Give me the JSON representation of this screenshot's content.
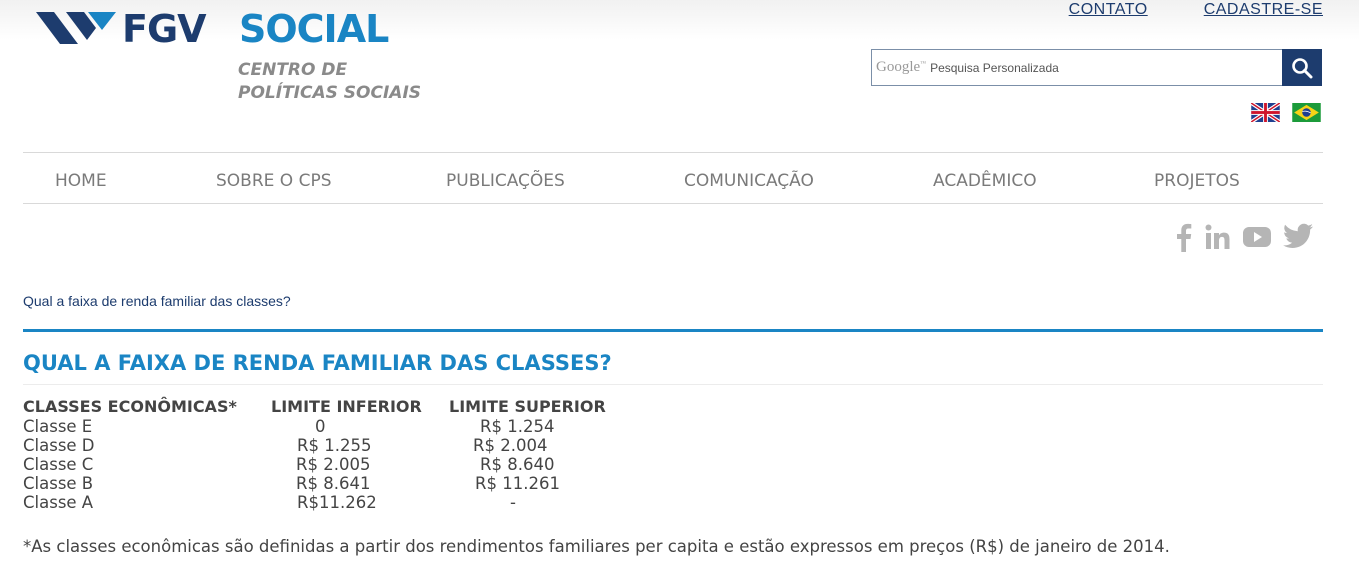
{
  "brand": {
    "logo_word1": "FGV",
    "logo_word2": "SOCIAL",
    "subtitle_line1": "CENTRO DE",
    "subtitle_line2": "POLÍTICAS SOCIAIS",
    "colors": {
      "navy": "#1d3c6e",
      "blue": "#1a85c4",
      "grey": "#8a8a8a"
    }
  },
  "top_links": {
    "contact": "CONTATO",
    "register": "CADASTRE-SE"
  },
  "search": {
    "google_label": "Google",
    "placeholder": "Pesquisa Personalizada",
    "button_icon": "search-icon"
  },
  "languages": [
    {
      "icon": "uk-flag-icon"
    },
    {
      "icon": "brazil-flag-icon"
    }
  ],
  "nav": {
    "items": [
      {
        "label": "HOME"
      },
      {
        "label": "SOBRE O CPS"
      },
      {
        "label": "PUBLICAÇÕES"
      },
      {
        "label": "COMUNICAÇÃO"
      },
      {
        "label": "ACADÊMICO"
      },
      {
        "label": "PROJETOS"
      }
    ]
  },
  "social": [
    "facebook-icon",
    "linkedin-icon",
    "youtube-icon",
    "twitter-icon"
  ],
  "breadcrumb": "Qual a faixa de renda familiar das classes?",
  "page_title": "QUAL A FAIXA DE RENDA FAMILIAR DAS CLASSES?",
  "table": {
    "headers": [
      "CLASSES ECONÔMICAS*",
      "LIMITE INFERIOR",
      "LIMITE SUPERIOR"
    ],
    "rows": [
      [
        "Classe E",
        "0",
        "R$ 1.254"
      ],
      [
        "Classe D",
        "R$ 1.255",
        "R$ 2.004"
      ],
      [
        "Classe C",
        "R$ 2.005",
        "R$ 8.640"
      ],
      [
        "Classe B",
        "R$ 8.641",
        "R$ 11.261"
      ],
      [
        "Classe A",
        "R$11.262",
        "-"
      ]
    ]
  },
  "footnote": "*As classes econômicas são definidas a partir dos rendimentos familiares per capita e estão expressos em preços (R$) de janeiro de 2014."
}
